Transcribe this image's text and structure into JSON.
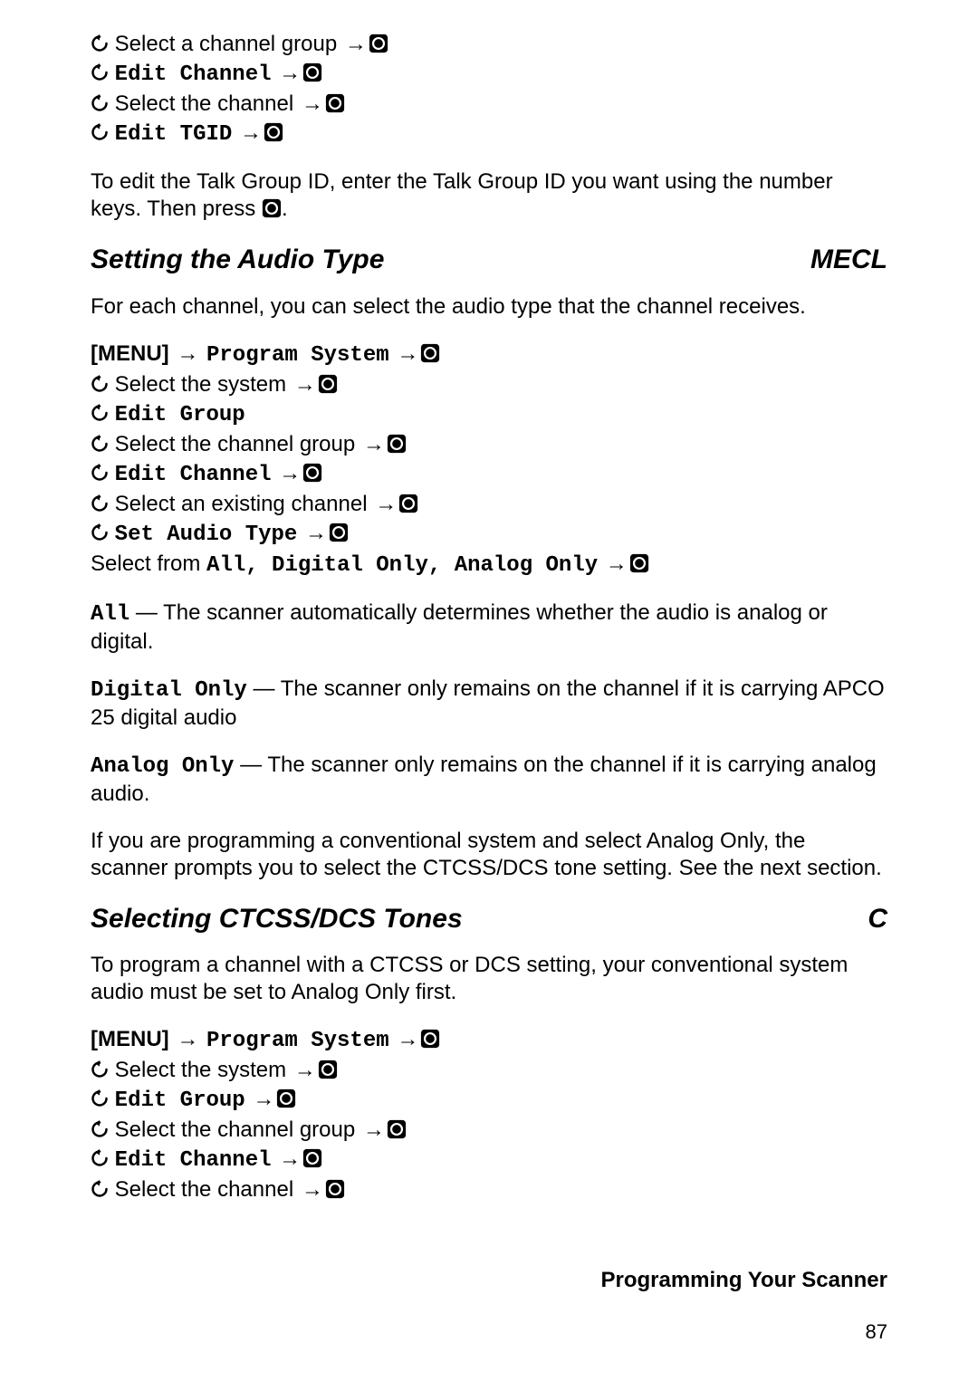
{
  "intro_steps": [
    {
      "pre_scroll": true,
      "text": "Select a channel group",
      "mono": false,
      "arrow": true,
      "enter": true
    },
    {
      "pre_scroll": true,
      "text": "Edit Channel",
      "mono": true,
      "arrow": true,
      "enter": true
    },
    {
      "pre_scroll": true,
      "text": "Select the channel",
      "mono": false,
      "arrow": true,
      "enter": true
    },
    {
      "pre_scroll": true,
      "text": "Edit TGID",
      "mono": true,
      "arrow": true,
      "enter": true
    }
  ],
  "intro_para_a": "To edit the Talk Group ID, enter the Talk Group ID you want using the number keys. Then press ",
  "intro_para_b": ".",
  "section1": {
    "title": "Setting the Audio Type",
    "tag": "MECL",
    "lead": "For each channel, you can select the audio type that the channel receives.",
    "menu_label": "[MENU]",
    "menu_item": "Program System",
    "steps": [
      {
        "pre_scroll": true,
        "text": "Select the system",
        "mono": false,
        "arrow": true,
        "enter": true
      },
      {
        "pre_scroll": true,
        "text": "Edit Group",
        "mono": true,
        "arrow": false,
        "enter": false
      },
      {
        "pre_scroll": true,
        "text": "Select the channel group",
        "mono": false,
        "arrow": true,
        "enter": true
      },
      {
        "pre_scroll": true,
        "text": "Edit Channel",
        "mono": true,
        "arrow": true,
        "enter": true
      },
      {
        "pre_scroll": true,
        "text": "Select an existing channel",
        "mono": false,
        "arrow": true,
        "enter": true
      },
      {
        "pre_scroll": true,
        "text": "Set Audio Type",
        "mono": true,
        "arrow": true,
        "enter": true
      }
    ],
    "select_from_a": "Select from ",
    "select_from_b": "All, Digital Only, Analog Only",
    "all_label": "All",
    "all_desc": " — The scanner automatically determines whether the audio is analog or digital.",
    "digital_label": "Digital Only",
    "digital_desc": " — The scanner only remains on the channel if it is carrying APCO 25 digital audio",
    "analog_label": "Analog Only",
    "analog_desc": " — The scanner only remains on the channel if it is carrying analog audio.",
    "note": "If you are programming a conventional system and select Analog Only, the scanner prompts you to select the CTCSS/DCS tone setting. See the next section."
  },
  "section2": {
    "title": "Selecting CTCSS/DCS Tones",
    "tag": "C",
    "lead": "To program a channel with a CTCSS or DCS setting, your conventional system audio must be set to Analog Only first.",
    "menu_label": "[MENU]",
    "menu_item": "Program System",
    "steps": [
      {
        "pre_scroll": true,
        "text": "Select the system",
        "mono": false,
        "arrow": true,
        "enter": true
      },
      {
        "pre_scroll": true,
        "text": "Edit Group",
        "mono": true,
        "arrow": true,
        "enter": true
      },
      {
        "pre_scroll": true,
        "text": "Select the channel group",
        "mono": false,
        "arrow": true,
        "enter": true
      },
      {
        "pre_scroll": true,
        "text": "Edit Channel",
        "mono": true,
        "arrow": true,
        "enter": true
      },
      {
        "pre_scroll": true,
        "text": "Select the channel",
        "mono": false,
        "arrow": true,
        "enter": true
      }
    ]
  },
  "footer": {
    "title": "Programming Your Scanner",
    "page": "87"
  }
}
